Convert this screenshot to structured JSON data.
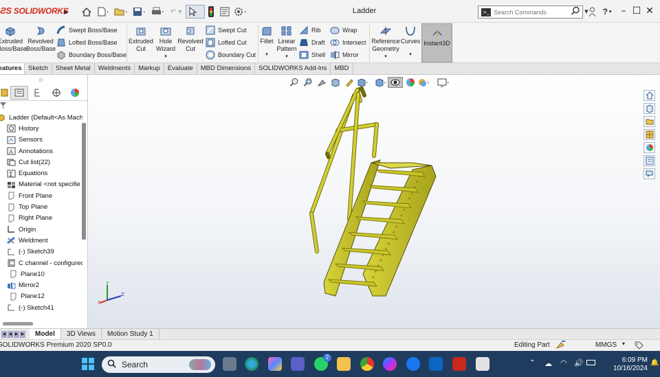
{
  "app": {
    "logo": "SOLIDWORKS",
    "document_title": "Ladder",
    "search_placeholder": "Search Commands"
  },
  "toolbar": {
    "features": [
      {
        "label": "Extruded\nBoss/Base",
        "icon": "extruded-boss-icon"
      },
      {
        "label": "Revolved\nBoss/Base",
        "icon": "revolved-boss-icon"
      },
      {
        "label": "Swept Boss/Base",
        "icon": "swept-boss-icon"
      },
      {
        "label": "Lofted Boss/Base",
        "icon": "lofted-boss-icon"
      },
      {
        "label": "Boundary Boss/Base",
        "icon": "boundary-boss-icon"
      },
      {
        "label": "Extruded\nCut",
        "icon": "extruded-cut-icon"
      },
      {
        "label": "Hole\nWizard",
        "icon": "hole-wizard-icon"
      },
      {
        "label": "Revolved\nCut",
        "icon": "revolved-cut-icon"
      },
      {
        "label": "Swept Cut",
        "icon": "swept-cut-icon"
      },
      {
        "label": "Lofted Cut",
        "icon": "lofted-cut-icon"
      },
      {
        "label": "Boundary Cut",
        "icon": "boundary-cut-icon"
      },
      {
        "label": "Fillet",
        "icon": "fillet-icon"
      },
      {
        "label": "Linear\nPattern",
        "icon": "linear-pattern-icon"
      },
      {
        "label": "Rib",
        "icon": "rib-icon"
      },
      {
        "label": "Draft",
        "icon": "draft-icon"
      },
      {
        "label": "Shell",
        "icon": "shell-icon"
      },
      {
        "label": "Wrap",
        "icon": "wrap-icon"
      },
      {
        "label": "Intersect",
        "icon": "intersect-icon"
      },
      {
        "label": "Mirror",
        "icon": "mirror-icon"
      },
      {
        "label": "Reference\nGeometry",
        "icon": "reference-geometry-icon"
      },
      {
        "label": "Curves",
        "icon": "curves-icon"
      },
      {
        "label": "Instant3D",
        "icon": "instant3d-icon"
      }
    ]
  },
  "tabs": [
    "Features",
    "Sketch",
    "Sheet Metal",
    "Weldments",
    "Markup",
    "Evaluate",
    "MBD Dimensions",
    "SOLIDWORKS Add-Ins",
    "MBD"
  ],
  "tree": [
    {
      "label": "Ladder  (Default<As Machi",
      "icon": "part-icon"
    },
    {
      "label": "History",
      "icon": "history-icon"
    },
    {
      "label": "Sensors",
      "icon": "sensors-icon"
    },
    {
      "label": "Annotations",
      "icon": "annotations-icon"
    },
    {
      "label": "Cut list(22)",
      "icon": "cut-list-icon"
    },
    {
      "label": "Equations",
      "icon": "equations-icon"
    },
    {
      "label": "Material <not specifie",
      "icon": "material-icon"
    },
    {
      "label": "Front Plane",
      "icon": "plane-icon"
    },
    {
      "label": "Top Plane",
      "icon": "plane-icon"
    },
    {
      "label": "Right Plane",
      "icon": "plane-icon"
    },
    {
      "label": "Origin",
      "icon": "origin-icon"
    },
    {
      "label": "Weldment",
      "icon": "weldment-icon"
    },
    {
      "label": "(-) Sketch39",
      "icon": "sketch-icon"
    },
    {
      "label": "C channel - configurec",
      "icon": "structural-member-icon"
    },
    {
      "label": "Plane10",
      "icon": "plane-icon"
    },
    {
      "label": "Mirror2",
      "icon": "mirror-icon"
    },
    {
      "label": "Plane12",
      "icon": "plane-icon"
    },
    {
      "label": "(-) Sketch41",
      "icon": "sketch-icon"
    }
  ],
  "bottom_tabs": [
    "Model",
    "3D Views",
    "Motion Study 1"
  ],
  "status": {
    "product": "SOLIDWORKS Premium 2020 SP0.0",
    "mode": "Editing Part",
    "units": "MMGS"
  },
  "taskbar": {
    "search_label": "Search",
    "time": "6:09 PM",
    "date": "10/16/2024",
    "whatsapp_badge": "2"
  },
  "colors": {
    "model": "#c9c52a",
    "model_dark": "#7f7c10",
    "accent_red": "#d52b1e"
  }
}
